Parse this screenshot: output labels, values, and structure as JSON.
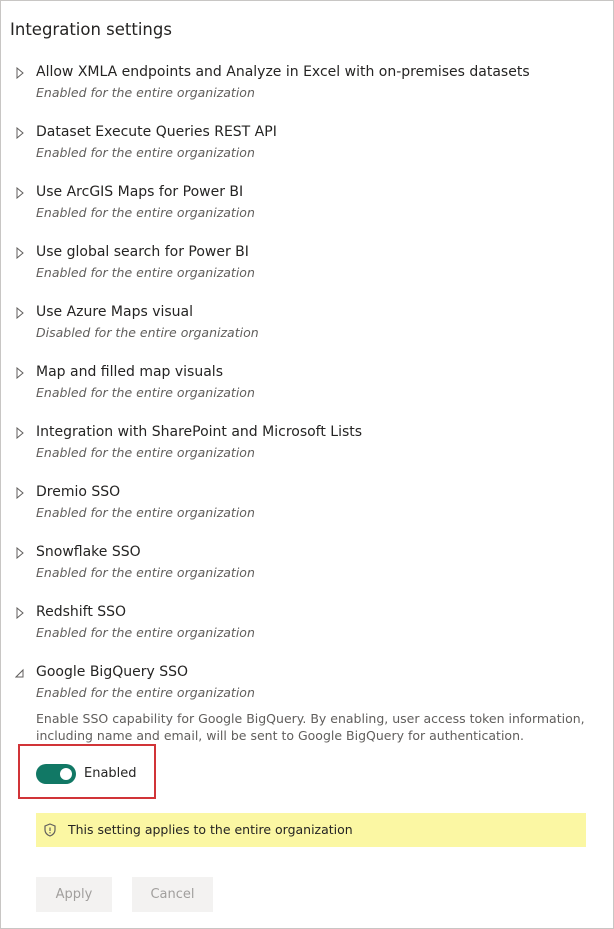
{
  "section": {
    "title": "Integration settings"
  },
  "settings": [
    {
      "title": "Allow XMLA endpoints and Analyze in Excel with on-premises datasets",
      "status": "Enabled for the entire organization",
      "expanded": false
    },
    {
      "title": "Dataset Execute Queries REST API",
      "status": "Enabled for the entire organization",
      "expanded": false
    },
    {
      "title": "Use ArcGIS Maps for Power BI",
      "status": "Enabled for the entire organization",
      "expanded": false
    },
    {
      "title": "Use global search for Power BI",
      "status": "Enabled for the entire organization",
      "expanded": false
    },
    {
      "title": "Use Azure Maps visual",
      "status": "Disabled for the entire organization",
      "expanded": false
    },
    {
      "title": "Map and filled map visuals",
      "status": "Enabled for the entire organization",
      "expanded": false
    },
    {
      "title": "Integration with SharePoint and Microsoft Lists",
      "status": "Enabled for the entire organization",
      "expanded": false
    },
    {
      "title": "Dremio SSO",
      "status": "Enabled for the entire organization",
      "expanded": false
    },
    {
      "title": "Snowflake SSO",
      "status": "Enabled for the entire organization",
      "expanded": false
    },
    {
      "title": "Redshift SSO",
      "status": "Enabled for the entire organization",
      "expanded": false
    },
    {
      "title": "Google BigQuery SSO",
      "status": "Enabled for the entire organization",
      "expanded": true
    }
  ],
  "expanded_setting": {
    "description": "Enable SSO capability for Google BigQuery. By enabling, user access token information, including name and email, will be sent to Google BigQuery for authentication.",
    "toggle_label": "Enabled",
    "toggle_on": true,
    "banner_text": "This setting applies to the entire organization",
    "banner_icon": "shield-icon"
  },
  "buttons": {
    "apply": "Apply",
    "cancel": "Cancel"
  },
  "colors": {
    "toggle_on": "#117865",
    "banner_bg": "#fbf7a3",
    "highlight": "#d13438"
  }
}
